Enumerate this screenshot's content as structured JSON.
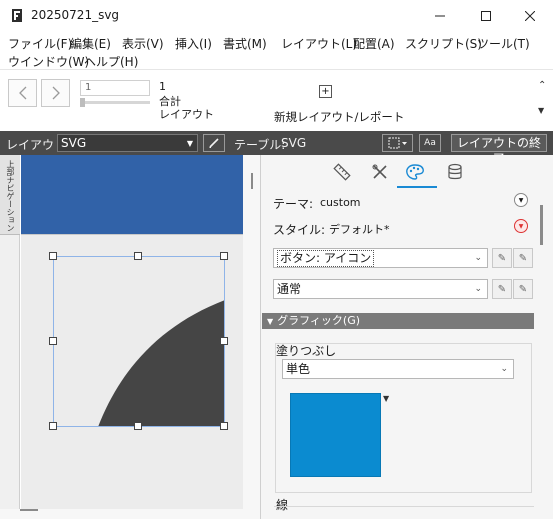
{
  "window": {
    "title": "20250721_svg",
    "app_icon": "filemaker-icon",
    "controls": [
      "minimize-icon",
      "maximize-icon",
      "close-icon"
    ]
  },
  "menu": {
    "row1": [
      "ファイル(F)",
      "編集(E)",
      "表示(V)",
      "挿入(I)",
      "書式(M)",
      "レイアウト(L)",
      "配置(A)",
      "スクリプト(S)",
      "ツール(T)"
    ],
    "row2": [
      "ウインドウ(W)",
      "ヘルプ(H)"
    ]
  },
  "toolbar": {
    "record_field_value": "1",
    "record_count": "1",
    "total_label": "合計",
    "layout_label": "レイアウト",
    "new_layout_label": "新規レイアウト/レポート",
    "icons": [
      "back-icon",
      "forward-icon",
      "new-layout-icon",
      "collapse-toolbar-icon",
      "more-icon"
    ]
  },
  "layout_bar": {
    "layout_label": "レイアウト:",
    "layout_value": "SVG",
    "table_label": "テーブル:",
    "table_value": "SVG",
    "aa_label": "Aa",
    "exit_button": "レイアウトの終了",
    "icons": [
      "pencil-icon",
      "selection-tool-icon"
    ]
  },
  "navigation": {
    "tab_label": "上部ナビゲーション"
  },
  "canvas": {
    "header_color": "#3162a8",
    "shape_color": "#454545",
    "selection_color": "#8fb4e8"
  },
  "inspector": {
    "tabs": [
      "ruler-icon",
      "tools-icon",
      "palette-icon",
      "database-icon"
    ],
    "active_tab_index": 2,
    "theme_label": "テーマ:",
    "theme_value": "custom",
    "style_label": "スタイル:",
    "style_value": "デフォルト*",
    "object_select": "ボタン: アイコン",
    "state_select": "通常",
    "graphic_section": "グラフィック(G)",
    "fill_label": "塗りつぶし",
    "fill_type": "単色",
    "fill_color": "#0b8bd0",
    "line_label": "線",
    "accent_color": "#1a8ad4"
  }
}
